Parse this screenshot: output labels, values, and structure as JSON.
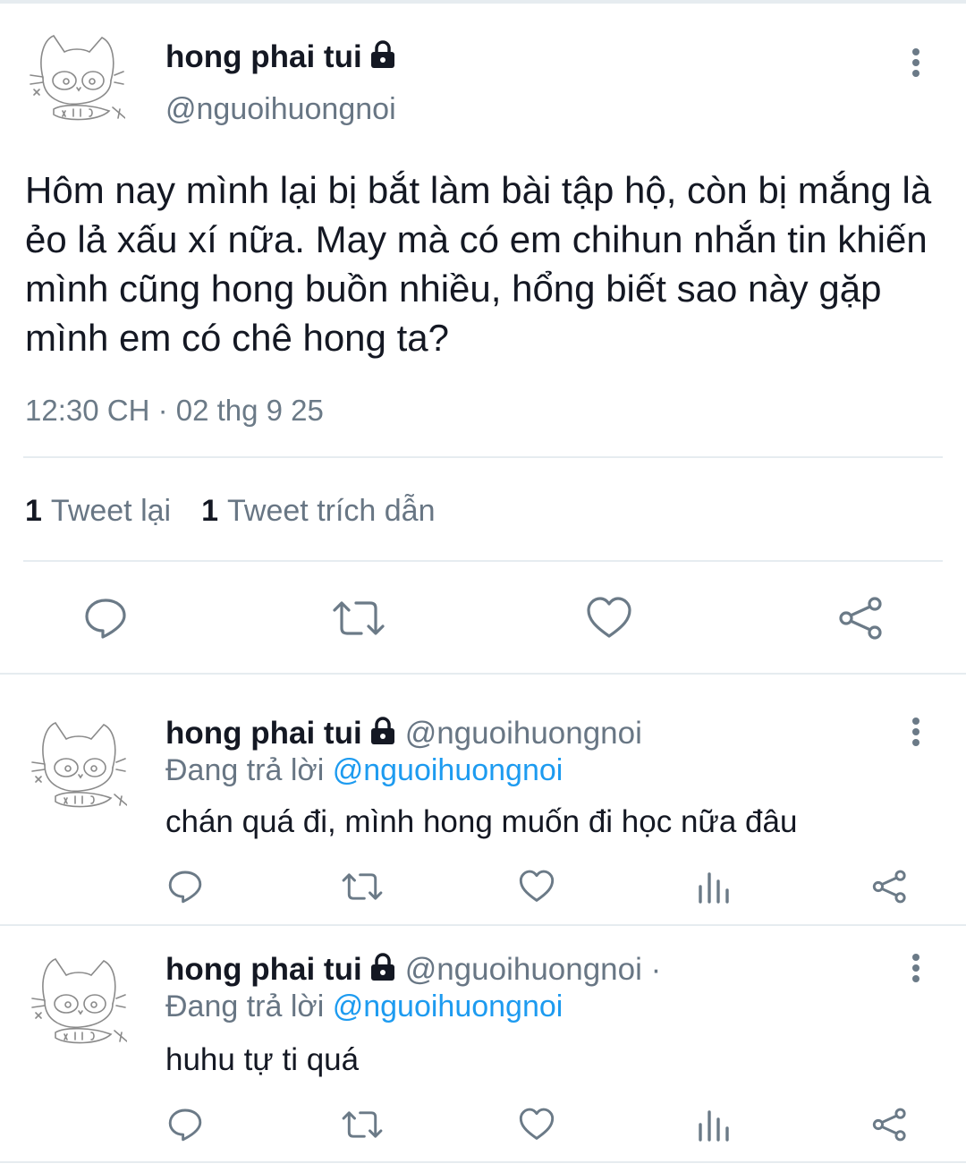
{
  "main_tweet": {
    "name": "hong phai tui",
    "handle": "@nguoihuongnoi",
    "text": "Hôm nay mình lại bị bắt làm bài tập hộ, còn bị mắng là ẻo lả xấu xí nữa. May mà có em chihun nhắn tin khiến mình cũng hong buồn nhiều, hổng biết sao này gặp mình em có chê hong ta?",
    "timestamp": "12:30 CH · 02 thg 9 25",
    "retweet_count": "1",
    "retweet_label": "Tweet lại",
    "quote_count": "1",
    "quote_label": "Tweet trích dẫn"
  },
  "replies": [
    {
      "name": "hong phai tui",
      "handle": "@nguoihuongnoi",
      "replying_prefix": "Đang trả lời",
      "replying_to": "@nguoihuongnoi",
      "text": "chán quá đi, mình hong muốn đi học nữa đâu"
    },
    {
      "name": "hong phai tui",
      "handle": "@nguoihuongnoi ·",
      "replying_prefix": "Đang trả lời",
      "replying_to": "@nguoihuongnoi",
      "text": "huhu tự ti quá"
    }
  ],
  "icons": {
    "reply": "reply-icon",
    "retweet": "retweet-icon",
    "like": "heart-icon",
    "views": "analytics-icon",
    "share": "share-icon",
    "more": "more-vertical-icon",
    "lock": "lock-icon"
  },
  "colors": {
    "text": "#141823",
    "secondary": "#687684",
    "accent": "#1d9bf0",
    "divider": "#e6ecf0"
  }
}
